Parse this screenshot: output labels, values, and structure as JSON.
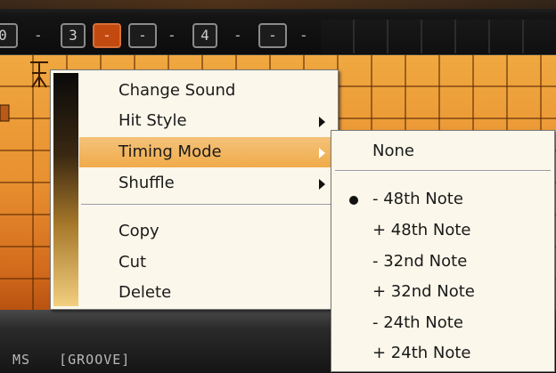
{
  "toolbar": {
    "steps": [
      {
        "label": "0",
        "active": false
      },
      {
        "label": "3",
        "active": false
      },
      {
        "label": "-",
        "active": true
      },
      {
        "label": "-",
        "active": false
      },
      {
        "label": "4",
        "active": false
      },
      {
        "label": "-",
        "active": false
      }
    ],
    "separators": [
      "-",
      "-",
      "-",
      "-",
      "-"
    ]
  },
  "bottom_bar": {
    "labels": [
      "MS",
      "[GROOVE]"
    ]
  },
  "context_menu": {
    "items": [
      {
        "label": "Change Sound",
        "submenu": false,
        "highlighted": false
      },
      {
        "label": "Hit Style",
        "submenu": true,
        "highlighted": false
      },
      {
        "label": "Timing Mode",
        "submenu": true,
        "highlighted": true
      },
      {
        "label": "Shuffle",
        "submenu": true,
        "highlighted": false
      },
      {
        "label": "Copy",
        "submenu": false,
        "highlighted": false
      },
      {
        "label": "Cut",
        "submenu": false,
        "highlighted": false
      },
      {
        "label": "Delete",
        "submenu": false,
        "highlighted": false
      }
    ]
  },
  "timing_submenu": {
    "items": [
      {
        "label": "None",
        "selected": false
      },
      {
        "label": "- 48th Note",
        "selected": true
      },
      {
        "label": "+ 48th Note",
        "selected": false
      },
      {
        "label": "- 32nd Note",
        "selected": false
      },
      {
        "label": "+ 32nd Note",
        "selected": false
      },
      {
        "label": "- 24th Note",
        "selected": false
      },
      {
        "label": "+ 24th Note",
        "selected": false
      }
    ]
  },
  "colors": {
    "accent_orange": "#c24a10",
    "grid_orange": "#e89030",
    "menu_bg": "#fbf7ea",
    "menu_highlight": "#f0ab4a"
  }
}
